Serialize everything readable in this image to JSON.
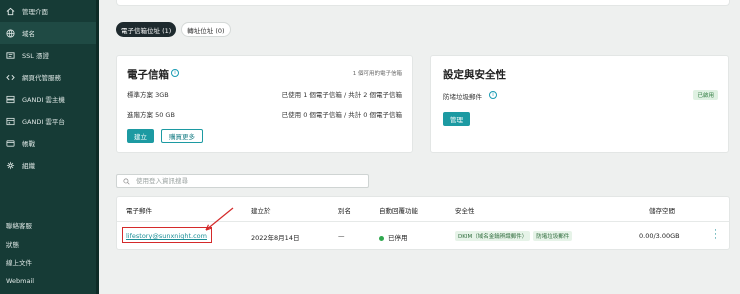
{
  "sidebar": {
    "items": [
      {
        "label": "管理介面",
        "icon": "home-icon"
      },
      {
        "label": "域名",
        "icon": "globe-icon"
      },
      {
        "label": "SSL 憑證",
        "icon": "ssl-icon"
      },
      {
        "label": "網頁代管服務",
        "icon": "code-icon"
      },
      {
        "label": "GANDI 雲主機",
        "icon": "server-icon"
      },
      {
        "label": "GANDI 雲平台",
        "icon": "cloud-platform-icon"
      },
      {
        "label": "帳戰",
        "icon": "billing-icon"
      },
      {
        "label": "組織",
        "icon": "organization-icon"
      }
    ],
    "links": [
      "聯絡客服",
      "狀態",
      "線上文件",
      "Webmail"
    ]
  },
  "tabs": [
    {
      "label": "電子信箱位址 (1)"
    },
    {
      "label": "轉址位址 (0)"
    }
  ],
  "mail_card": {
    "title": "電子信箱",
    "available_note": "1 個可用的電子信箱",
    "plans": [
      {
        "name": "標準方案 3GB",
        "usage": "已使用 1 個電子信箱 / 共計 2 個電子信箱"
      },
      {
        "name": "進階方案 50 GB",
        "usage": "已使用 0 個電子信箱 / 共計 0 個電子信箱"
      }
    ],
    "create_label": "建立",
    "buy_more_label": "購買更多"
  },
  "security_card": {
    "title": "設定與安全性",
    "spam_label": "防堵垃圾郵件",
    "spam_status": "已啟用",
    "manage_label": "管理"
  },
  "search": {
    "placeholder": "使用登入資訊搜尋"
  },
  "table": {
    "headers": {
      "email": "電子郵件",
      "created": "建立於",
      "alias": "別名",
      "autoreply": "自動回覆功能",
      "security": "安全性",
      "storage": "儲存空間"
    },
    "rows": [
      {
        "email": "lifestory@sunxnight.com",
        "created": "2022年8月14日",
        "alias": "—",
        "autoreply": "已停用",
        "security_tags": [
          "DKIM（域名金鑰辨識郵件）",
          "防堵垃圾郵件"
        ],
        "storage": "0.00/3.00GB"
      }
    ]
  },
  "colors": {
    "sidebar_bg": "#163b36",
    "accent": "#1c9aa2",
    "highlight_red": "#d42a2a"
  }
}
